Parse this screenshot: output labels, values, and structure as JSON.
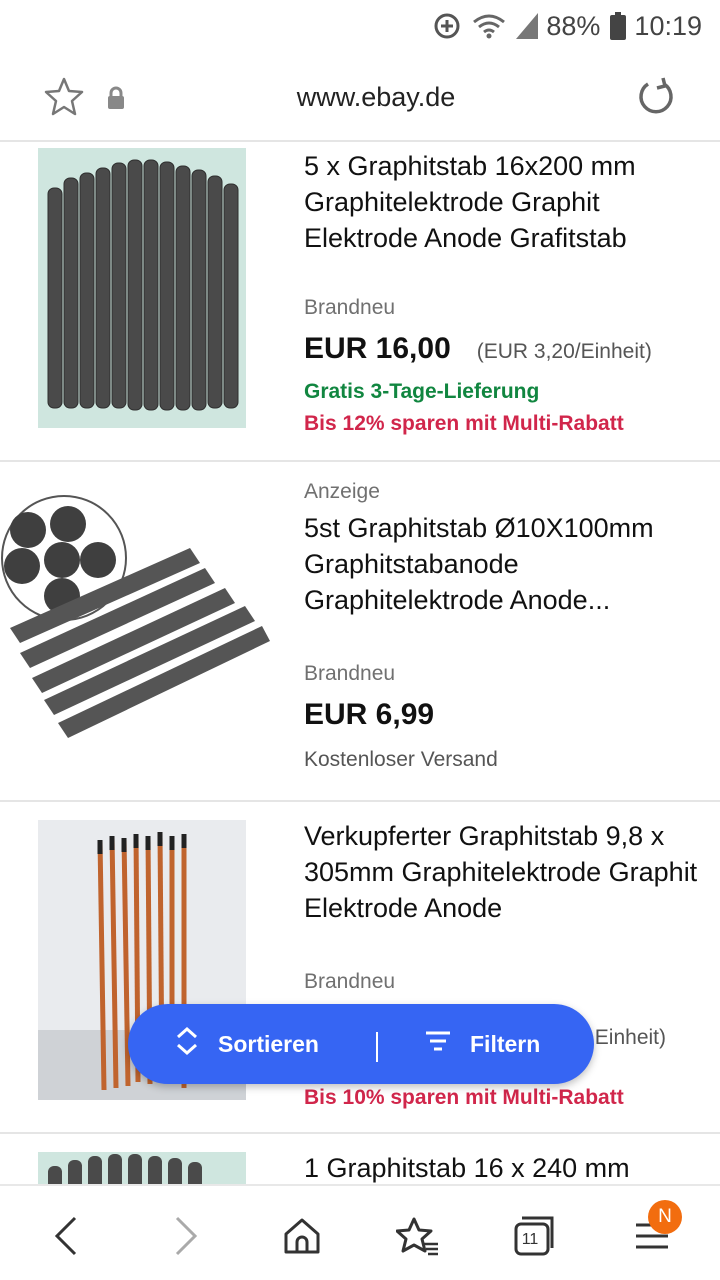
{
  "status_bar": {
    "battery": "88%",
    "time": "10:19",
    "icons": [
      "data-saver-icon",
      "wifi-icon",
      "signal-icon",
      "battery-icon"
    ]
  },
  "browser": {
    "url": "www.ebay.de",
    "icons": [
      "bookmark-star-icon",
      "lock-icon",
      "reload-icon"
    ]
  },
  "listings": [
    {
      "ad_label": "",
      "title": "5 x Graphitstab 16x200 mm Graphitelektrode Graphit Elektrode Anode Grafitstab",
      "condition": "Brandneu",
      "price": "EUR 16,00",
      "unit_price": "(EUR 3,20/Einheit)",
      "shipping": "Gratis 3-Tage-Lieferung",
      "promo": "Bis 12% sparen mit Multi-Rabatt"
    },
    {
      "ad_label": "Anzeige",
      "title": "5st Graphitstab Ø10X100mm Graphitstabanode Graphitelektrode Anode...",
      "condition": "Brandneu",
      "price": "EUR 6,99",
      "unit_price": "",
      "shipping": "Kostenloser Versand",
      "promo": ""
    },
    {
      "ad_label": "",
      "title": "Verkupferter Graphitstab 9,8 x 305mm Graphitelektrode Graphit Elektrode Anode",
      "condition": "Brandneu",
      "price": "",
      "unit_price": "Einheit)",
      "shipping": "",
      "promo": "Bis 10% sparen mit Multi-Rabatt"
    },
    {
      "ad_label": "",
      "title": "1 Graphitstab 16 x 240 mm",
      "condition": "",
      "price": "",
      "unit_price": "",
      "shipping": "",
      "promo": ""
    }
  ],
  "fab": {
    "sort_label": "Sortieren",
    "filter_label": "Filtern",
    "icons": [
      "sort-chevrons-icon",
      "filter-lines-icon"
    ]
  },
  "bottom_nav": {
    "tab_count": "11",
    "badge": "N",
    "icons": [
      "back-icon",
      "forward-icon",
      "home-icon",
      "bookmarks-icon",
      "tabs-icon",
      "menu-icon"
    ]
  },
  "colors": {
    "accent_blue": "#3665f3",
    "shipping_green": "#118640",
    "promo_red": "#d1264b",
    "badge_orange": "#f26d0f"
  }
}
